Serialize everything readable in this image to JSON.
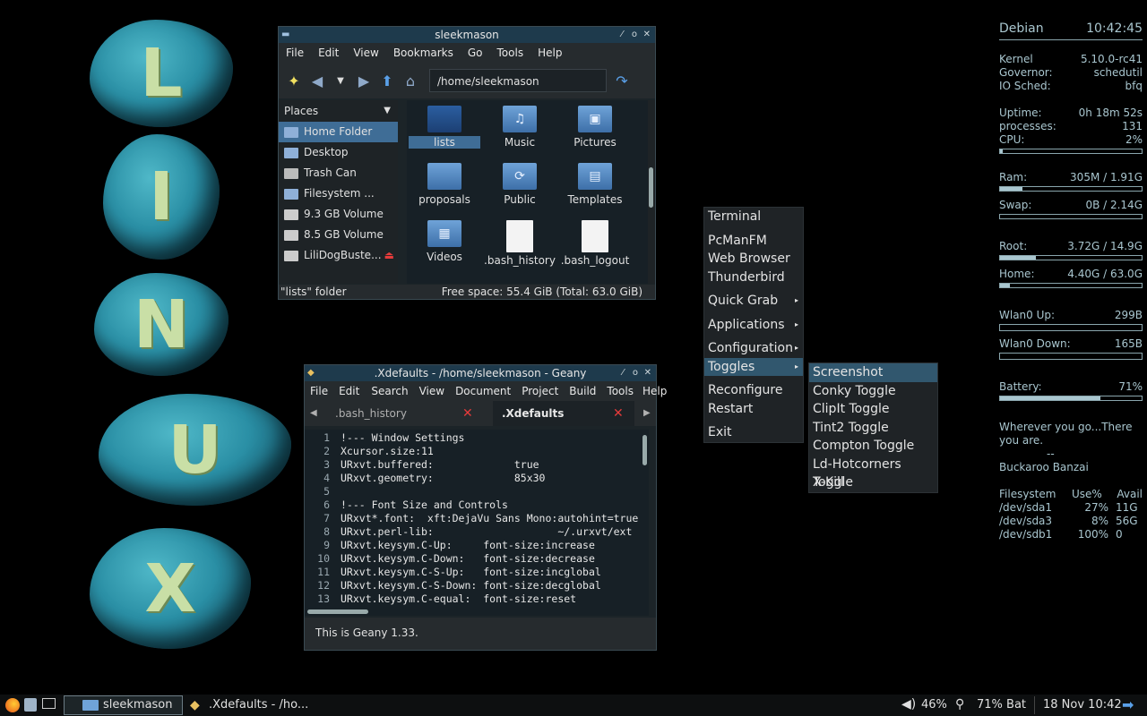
{
  "desktop": {
    "stone_letters": [
      "L",
      "I",
      "N",
      "U",
      "X"
    ]
  },
  "pcmanfm": {
    "title": "sleekmason",
    "menu": [
      "File",
      "Edit",
      "View",
      "Bookmarks",
      "Go",
      "Tools",
      "Help"
    ],
    "path": "/home/sleekmason",
    "places_label": "Places",
    "places": [
      "Home Folder",
      "Desktop",
      "Trash Can",
      "Filesystem ...",
      "9.3 GB Volume",
      "8.5 GB Volume",
      "LiliDogBuste..."
    ],
    "files": [
      {
        "name": "lists",
        "kind": "folder-dark",
        "glyph": ""
      },
      {
        "name": "Music",
        "kind": "folder",
        "glyph": "♫"
      },
      {
        "name": "Pictures",
        "kind": "folder",
        "glyph": "▣"
      },
      {
        "name": "proposals",
        "kind": "folder",
        "glyph": ""
      },
      {
        "name": "Public",
        "kind": "folder",
        "glyph": "⟳"
      },
      {
        "name": "Templates",
        "kind": "folder",
        "glyph": "▤"
      },
      {
        "name": "Videos",
        "kind": "folder",
        "glyph": "▦"
      },
      {
        "name": ".bash_history",
        "kind": "doc",
        "glyph": ""
      },
      {
        "name": ".bash_logout",
        "kind": "doc",
        "glyph": ""
      }
    ],
    "status_left": "\"lists\" folder",
    "status_right": "Free space: 55.4 GiB (Total: 63.0 GiB)"
  },
  "geany": {
    "title": ".Xdefaults - /home/sleekmason - Geany",
    "menu": [
      "File",
      "Edit",
      "Search",
      "View",
      "Document",
      "Project",
      "Build",
      "Tools",
      "Help"
    ],
    "tabs": [
      ".bash_history",
      ".Xdefaults"
    ],
    "line_numbers": [
      "1",
      "2",
      "3",
      "4",
      "5",
      "6",
      "7",
      "8",
      "9",
      "10",
      "11",
      "12",
      "13"
    ],
    "lines": [
      "!--- Window Settings",
      "Xcursor.size:11",
      "URxvt.buffered:             true",
      "URxvt.geometry:             85x30",
      "",
      "!--- Font Size and Controls",
      "URxvt*.font:  xft:DejaVu Sans Mono:autohint=true",
      "URxvt.perl-lib:                    ~/.urxvt/ext",
      "URxvt.keysym.C-Up:     font-size:increase",
      "URxvt.keysym.C-Down:   font-size:decrease",
      "URxvt.keysym.C-S-Up:   font-size:incglobal",
      "URxvt.keysym.C-S-Down: font-size:decglobal",
      "URxvt.keysym.C-equal:  font-size:reset"
    ],
    "status": "This is Geany 1.33."
  },
  "root_menu": {
    "items": [
      {
        "label": "Terminal",
        "sub": false
      },
      {
        "sep": true
      },
      {
        "label": "PcManFM",
        "sub": false
      },
      {
        "label": "Web Browser",
        "sub": false
      },
      {
        "label": "Thunderbird",
        "sub": false
      },
      {
        "sep": true
      },
      {
        "label": "Quick Grab",
        "sub": true
      },
      {
        "sep": true
      },
      {
        "label": "Applications",
        "sub": true
      },
      {
        "sep": true
      },
      {
        "label": "Configuration",
        "sub": true
      },
      {
        "label": "Toggles",
        "sub": true,
        "highlight": true
      },
      {
        "sep": true
      },
      {
        "label": "Reconfigure",
        "sub": false
      },
      {
        "label": "Restart",
        "sub": false
      },
      {
        "sep": true
      },
      {
        "label": "Exit",
        "sub": false
      }
    ]
  },
  "toggles_menu": {
    "items": [
      "Screenshot",
      "Conky Toggle",
      "ClipIt Toggle",
      "Tint2 Toggle",
      "Compton Toggle",
      "Ld-Hotcorners Toggle",
      "X-Kill"
    ]
  },
  "conky": {
    "host": "Debian",
    "time": "10:42:45",
    "kernel_label": "Kernel",
    "kernel": "5.10.0-rc41",
    "governor_label": "Governor:",
    "governor": "schedutil",
    "iosched_label": "IO Sched:",
    "iosched": "bfq",
    "uptime_label": "Uptime:",
    "uptime": "0h 18m 52s",
    "processes_label": "processes:",
    "processes": "131",
    "cpu_label": "CPU:",
    "cpu": "2%",
    "cpu_level": 0.02,
    "ram_label": "Ram:",
    "ram": "305M  / 1.91G",
    "ram_level": 0.16,
    "swap_label": "Swap:",
    "swap": "0B  / 2.14G",
    "swap_level": 0.0,
    "root_label": "Root:",
    "root": "3.72G / 14.9G",
    "root_level": 0.25,
    "home_label": "Home:",
    "home": "4.40G / 63.0G",
    "home_level": 0.07,
    "wlan_up_label": "Wlan0 Up:",
    "wlan_up": "299B",
    "wlan_down_label": "Wlan0 Down:",
    "wlan_down": "165B",
    "battery_label": "Battery:",
    "battery": "71%",
    "battery_level": 0.71,
    "quote1": "Wherever you go...There",
    "quote2": "you are.",
    "quote3": "--",
    "quote4": "Buckaroo Banzai",
    "fs_header": [
      "Filesystem",
      "Use%",
      "Avail"
    ],
    "fs": [
      [
        "/dev/sda1",
        "27%",
        "11G"
      ],
      [
        "/dev/sda3",
        "8%",
        "56G"
      ],
      [
        "/dev/sdb1",
        "100%",
        "0"
      ]
    ]
  },
  "taskbar": {
    "task1": "sleekmason",
    "task2": ".Xdefaults - /ho...",
    "volume": "46%",
    "battery": "71% Bat",
    "clock": "18 Nov 10:42"
  },
  "colors": {
    "accent": "#3f6d96",
    "titlebar": "#1e3a4c",
    "conky": "#a9c6cf"
  }
}
